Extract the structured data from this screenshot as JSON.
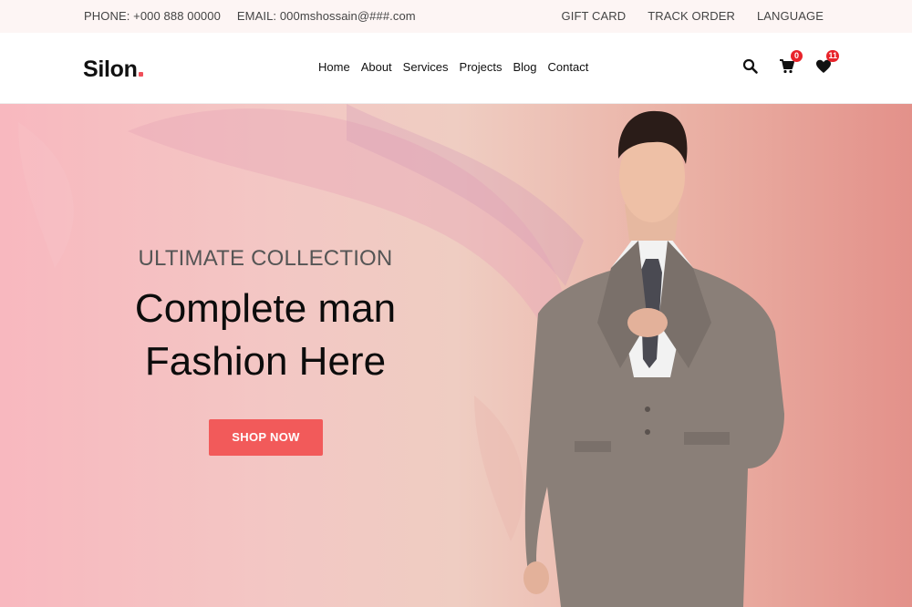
{
  "topbar": {
    "phone": "PHONE: +000 888 00000",
    "email": "EMAIL: 000mshossain@###.com",
    "links": [
      "GIFT CARD",
      "TRACK ORDER",
      "LANGUAGE"
    ]
  },
  "header": {
    "logo": "Silon",
    "nav": [
      "Home",
      "About",
      "Services",
      "Projects",
      "Blog",
      "Contact"
    ],
    "cart_count": "0",
    "wishlist_count": "11"
  },
  "hero": {
    "subtitle": "ULTIMATE COLLECTION",
    "title_line1": "Complete man",
    "title_line2": "Fashion Here",
    "button": "SHOP NOW"
  },
  "colors": {
    "accent": "#f25a5a",
    "badge": "#e8232a",
    "topbar_bg": "#fdf5f4"
  },
  "icons": {
    "search": "search-icon",
    "cart": "cart-icon",
    "wishlist": "heart-icon"
  }
}
